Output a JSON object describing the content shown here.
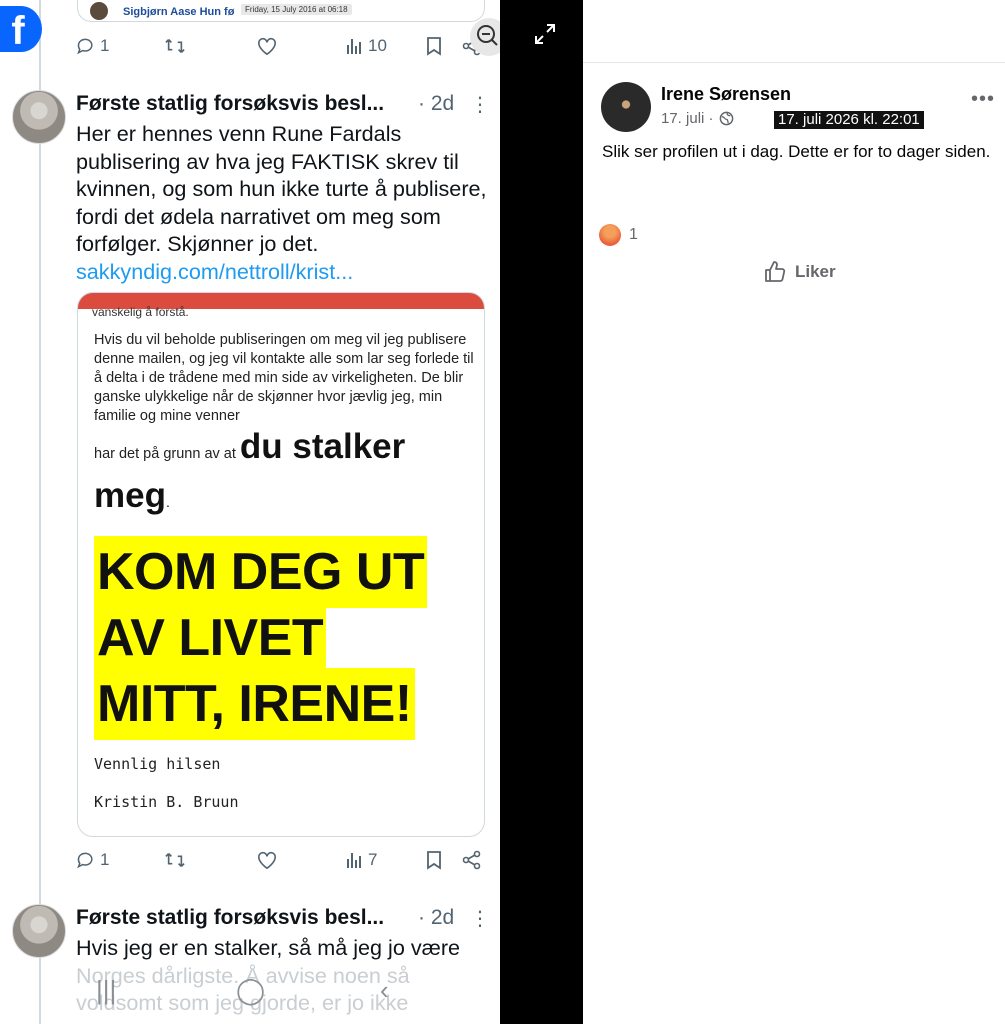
{
  "left": {
    "quote_stub": {
      "name": "Sigbjørn Aase Hun fø",
      "tooltip": "Friday, 15 July 2016 at 06:18"
    },
    "top_actions": {
      "replies": "1",
      "reposts": "",
      "likes": "",
      "views": "10"
    },
    "post1": {
      "author": "Første statlig forsøksvis besl...",
      "time": "· 2d",
      "more": "⋮",
      "text": "Her er hennes venn Rune Fardals publisering av hva jeg FAKTISK skrev til kvinnen, og som hun ikke turte å publisere, fordi det ødela narrativet om meg som forfølger. Skjønner jo det.",
      "link": "sakkyndig.com/nettroll/krist...",
      "card": {
        "cut_text": "vanskelig å forstå.",
        "mail": "Hvis du vil beholde publiseringen om meg vil jeg publisere denne mailen, og jeg vil kontakte alle som lar seg forlede til å delta i de trådene med min side av virkeligheten. De blir ganske ulykkelige når de skjønner hvor jævlig jeg, min familie og mine venner",
        "line_small": "har det på grunn av at",
        "line_big": "du stalker",
        "line_big2": "meg",
        "line_big2_dot": ".",
        "highlight": [
          "KOM DEG UT",
          "AV LIVET",
          "MITT, IRENE!"
        ],
        "greeting": "Vennlig hilsen",
        "signature": "Kristin B. Bruun"
      },
      "actions": {
        "replies": "1",
        "views": "7"
      }
    },
    "post2": {
      "author": "Første statlig forsøksvis besl...",
      "time": "· 2d",
      "more": "⋮",
      "text": "Hvis jeg er en stalker, så må jeg jo være",
      "faded": "Norges dårligste. Å avvise noen så voldsomt som jeg gjorde, er jo ikke"
    }
  },
  "right": {
    "author": "Irene Sørensen",
    "date": "17. juli ·",
    "tooltip": "17. juli 2026 kl. 22:01",
    "text": "Slik ser profilen ut i dag. Dette er for to dager siden.",
    "reaction_count": "1",
    "like_label": "Liker"
  },
  "colors": {
    "link": "#1d9bf0",
    "highlight": "#ffff00",
    "fb_blue": "#0866ff",
    "card_bar": "#db4b3e"
  }
}
